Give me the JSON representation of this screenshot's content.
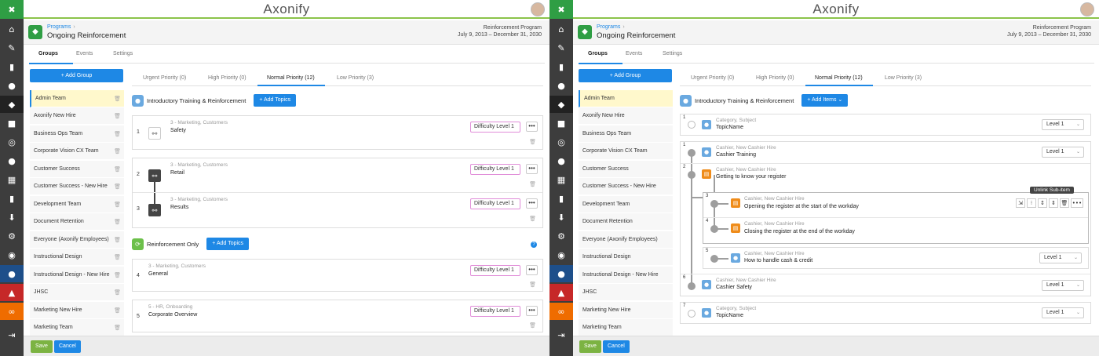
{
  "brand": "Axonify",
  "header": {
    "breadcrumb": "Programs",
    "title": "Ongoing Reinforcement",
    "program_type": "Reinforcement Program",
    "program_dates": "July 9, 2013 – December 31, 2030"
  },
  "tabs": [
    "Groups",
    "Events",
    "Settings"
  ],
  "sidebar": {
    "add_group_label": "Add Group",
    "groups": [
      "Admin Team",
      "Axonify New Hire",
      "Business Ops Team",
      "Corporate Vision CX Team",
      "Customer Success",
      "Customer Success - New Hire",
      "Development Team",
      "Document Retention",
      "Everyone (Axonify Employees)",
      "Instructional Design",
      "Instructional Design - New Hire",
      "JHSC",
      "Marketing New Hire",
      "Marketing Team"
    ]
  },
  "priority_tabs": [
    "Urgent Priority (0)",
    "High Priority (0)",
    "Normal Priority (12)",
    "Low Priority (3)"
  ],
  "left_panel": {
    "section1": {
      "title": "Introductory Training & Reinforcement",
      "button": "Add Topics"
    },
    "section2": {
      "title": "Reinforcement Only",
      "button": "Add Topics"
    },
    "topics": [
      {
        "num": "1",
        "meta": "3 - Marketing, Customers",
        "name": "Safety",
        "difficulty": "Difficulty Level 1"
      },
      {
        "num": "2",
        "meta": "3 - Marketing, Customers",
        "name": "Retail",
        "difficulty": "Difficulty Level 1"
      },
      {
        "num": "3",
        "meta": "3 - Marketing, Customers",
        "name": "Results",
        "difficulty": "Difficulty Level 1"
      },
      {
        "num": "4",
        "meta": "3 - Marketing, Customers",
        "name": "General",
        "difficulty": "Difficulty Level 1"
      },
      {
        "num": "5",
        "meta": "5 - HR, Onboarding",
        "name": "Corporate Overview",
        "difficulty": "Difficulty Level 1"
      }
    ],
    "more_label": "•••",
    "help_label": "?"
  },
  "right_panel": {
    "section1": {
      "title": "Introductory Training & Reinforcement",
      "button": "Add Items"
    },
    "tooltip": "Unlink Sub-item",
    "items": [
      {
        "num": "1",
        "meta": "Category, Subject",
        "name": "TopicName",
        "level": "Level 1"
      },
      {
        "num": "1",
        "meta": "Cashier, New Cashier Hire",
        "name": "Cashier Training",
        "level": "Level 1"
      },
      {
        "num": "2",
        "meta": "Cashier, New Cashier Hire",
        "name": "Getting to know your register",
        "level": ""
      },
      {
        "num": "3",
        "meta": "Cashier, New Cashier Hire",
        "name": "Opening the register at the start of the workday",
        "level": ""
      },
      {
        "num": "4",
        "meta": "Cashier, New Cashier Hire",
        "name": "Closing the register at the end of the workday",
        "level": ""
      },
      {
        "num": "5",
        "meta": "Cashier, New Cashier Hire",
        "name": "How to handle cash & credit",
        "level": "Level 1"
      },
      {
        "num": "6",
        "meta": "Cashier, New Cashier Hire",
        "name": "Cashier Safety",
        "level": "Level 1"
      },
      {
        "num": "7",
        "meta": "Category, Subject",
        "name": "TopicName",
        "level": "Level 1"
      }
    ]
  },
  "footer": {
    "save_label": "Save",
    "cancel_label": "Cancel"
  },
  "colors": {
    "accent": "#1e88e5",
    "brand_green": "#2f9e44",
    "rail": "#3d3d3d"
  }
}
